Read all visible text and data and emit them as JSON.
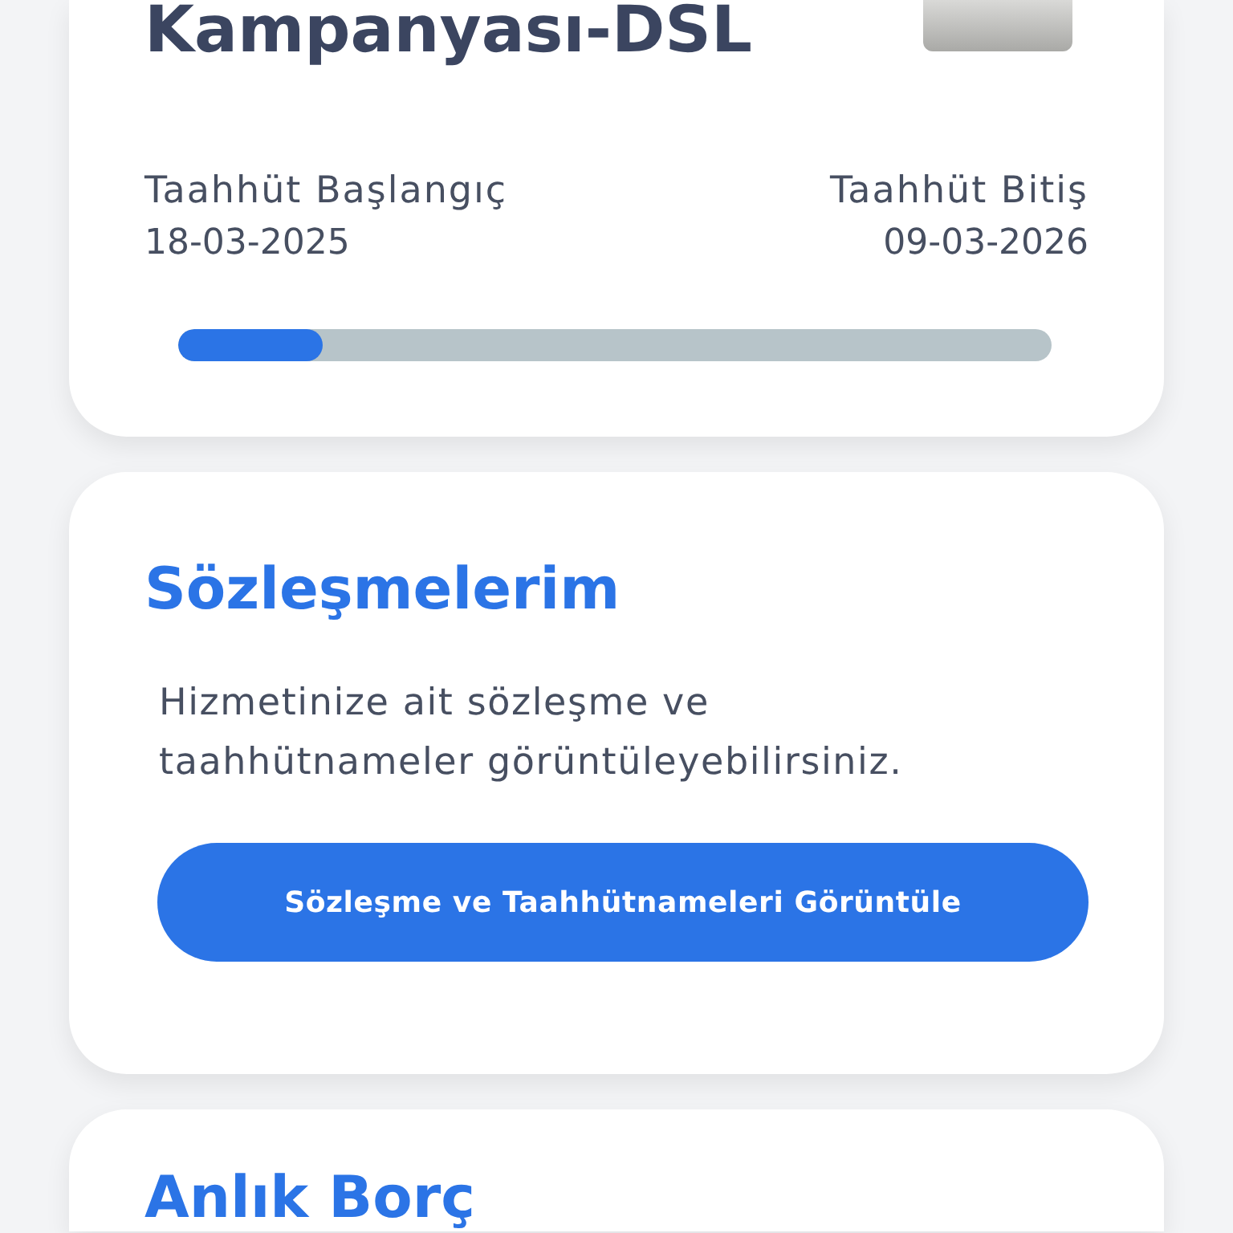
{
  "contract_card": {
    "title": "Kampanyası-DSL",
    "start": {
      "label": "Taahhüt Başlangıç",
      "date": "18-03-2025"
    },
    "end": {
      "label": "Taahhüt Bitiş",
      "date": "09-03-2026"
    },
    "progress": {
      "level": 0.165
    }
  },
  "contracts_card": {
    "title": "Sözleşmelerim",
    "description": "Hizmetinize ait sözleşme ve taahhütnameler görüntüleyebilirsiniz.",
    "button": "Sözleşme ve Taahhütnameleri Görüntüle"
  },
  "debt_card": {
    "title": "Anlık Borç"
  }
}
